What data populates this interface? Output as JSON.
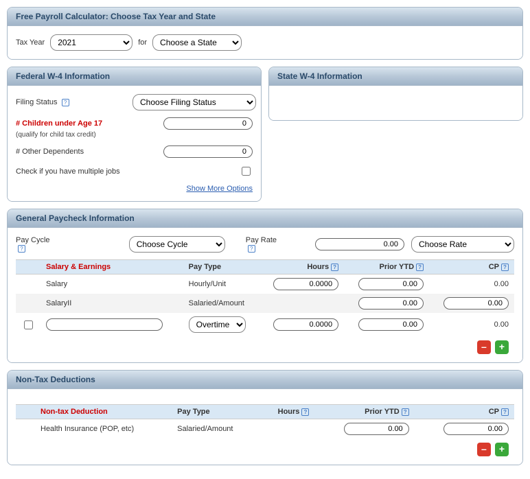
{
  "free": {
    "title": "Free Payroll Calculator: Choose Tax Year and State",
    "tax_year_label": "Tax Year",
    "tax_year_value": "2021",
    "for_label": "for",
    "state_value": "Choose a State"
  },
  "federal": {
    "title": "Federal W-4 Information",
    "filing_status_label": "Filing Status",
    "filing_status_value": "Choose Filing Status",
    "children_label": "# Children under Age 17",
    "children_sub": "(qualify for child tax credit)",
    "children_value": "0",
    "other_dep_label": "# Other Dependents",
    "other_dep_value": "0",
    "multi_jobs_label": "Check if you have multiple jobs",
    "show_more": "Show More Options"
  },
  "state": {
    "title": "State W-4 Information"
  },
  "general": {
    "title": "General Paycheck Information",
    "pay_cycle_label": "Pay Cycle",
    "pay_cycle_value": "Choose Cycle",
    "pay_rate_label": "Pay Rate",
    "pay_rate_value": "0.00",
    "rate_type_value": "Choose Rate",
    "headers": {
      "salary": "Salary & Earnings",
      "pay_type": "Pay Type",
      "hours": "Hours",
      "prior": "Prior YTD",
      "cp": "CP"
    },
    "rows": [
      {
        "name": "Salary",
        "pay_type": "Hourly/Unit",
        "hours": "0.0000",
        "prior": "0.00",
        "cp": "0.00",
        "editable_name": false,
        "hours_input": true,
        "cp_input": false,
        "select_type": false
      },
      {
        "name": "SalaryII",
        "pay_type": "Salaried/Amount",
        "hours": "",
        "prior": "0.00",
        "cp": "0.00",
        "editable_name": false,
        "hours_input": false,
        "cp_input": true,
        "select_type": false
      },
      {
        "name": "",
        "pay_type": "Overtime",
        "hours": "0.0000",
        "prior": "0.00",
        "cp": "0.00",
        "editable_name": true,
        "hours_input": true,
        "cp_input": false,
        "select_type": true,
        "checkbox": true
      }
    ]
  },
  "nontax": {
    "title": "Non-Tax Deductions",
    "headers": {
      "name": "Non-tax Deduction",
      "pay_type": "Pay Type",
      "hours": "Hours",
      "prior": "Prior YTD",
      "cp": "CP"
    },
    "rows": [
      {
        "name": "Health Insurance (POP, etc)",
        "pay_type": "Salaried/Amount",
        "prior": "0.00",
        "cp": "0.00"
      }
    ]
  },
  "glyph": {
    "help": "?",
    "minus": "–",
    "plus": "+"
  }
}
